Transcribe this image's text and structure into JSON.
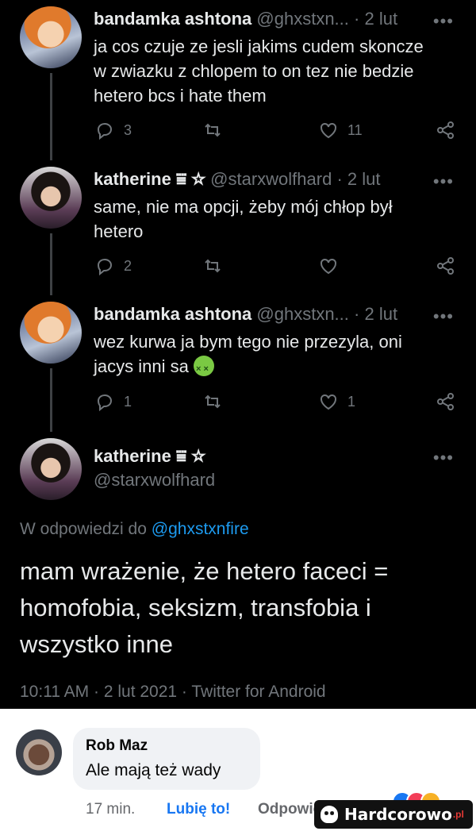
{
  "thread": [
    {
      "name": "bandamka ashtona",
      "handle": "@ghxstxn...",
      "sep": "·",
      "time": "2 lut",
      "text_lines": [
        "ja cos czuje ze jesli jakims cudem skoncze",
        "w zwiazku z chlopem to on tez nie bedzie",
        "hetero bcs i hate them"
      ],
      "replies": "3",
      "retweets": "",
      "likes": "11"
    },
    {
      "name": "katherine ⩸ ☆",
      "handle": "@starxwolfhard",
      "sep": "·",
      "time": "2 lut",
      "text_lines": [
        "same, nie ma opcji, żeby mój chłop był",
        "hetero"
      ],
      "replies": "2",
      "retweets": "",
      "likes": ""
    },
    {
      "name": "bandamka ashtona",
      "handle": "@ghxstxn...",
      "sep": "·",
      "time": "2 lut",
      "text_lines": [
        "wez kurwa ja bym tego nie przezyla, oni",
        "jacys inni sa"
      ],
      "emoji": "nauseated-face-icon",
      "replies": "1",
      "retweets": "",
      "likes": "1"
    }
  ],
  "main_tweet": {
    "name": "katherine ⩸ ☆",
    "handle": "@starxwolfhard",
    "reply_prefix": "W odpowiedzi do",
    "reply_to": "@ghxstxnfire",
    "text_lines": [
      "mam wrażenie, że hetero faceci =",
      "homofobia, seksizm, transfobia i",
      "wszystko inne"
    ],
    "timestamp": "10:11 AM · 2 lut 2021 · Twitter for Android"
  },
  "menu_dots": "•••",
  "comment": {
    "author": "Rob Maz",
    "text": "Ale mają też wady",
    "time": "17 min.",
    "like": "Lubię to!",
    "reply": "Odpowiedz"
  },
  "watermark": "Hardcorowo",
  "watermark_suffix": ".pl",
  "colors": {
    "background": "#000000",
    "text": "#e7e9ea",
    "muted": "#71767b",
    "link": "#1d9bf0",
    "fb_like": "#1877f2"
  }
}
